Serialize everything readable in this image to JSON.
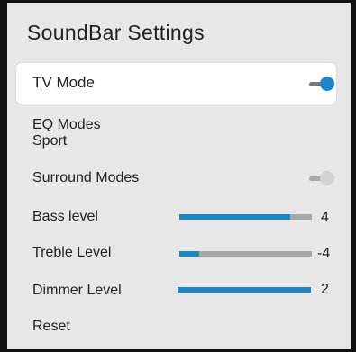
{
  "title": "SoundBar Settings",
  "colors": {
    "accent": "#1d87c6",
    "track": "#a7a7a7",
    "panel": "#e7e7e7"
  },
  "items": {
    "tv_mode": {
      "label": "TV Mode",
      "toggle": true
    },
    "eq_modes": {
      "label": "EQ Modes",
      "value": "Sport"
    },
    "surround": {
      "label": "Surround Modes",
      "toggle": false
    },
    "bass": {
      "label": "Bass level",
      "value": "4",
      "fraction": 0.84
    },
    "treble": {
      "label": "Treble Level",
      "value": "-4",
      "fraction": 0.15
    },
    "dimmer": {
      "label": "Dimmer Level",
      "value": "2",
      "fraction": 1.0
    },
    "reset": {
      "label": "Reset"
    }
  }
}
